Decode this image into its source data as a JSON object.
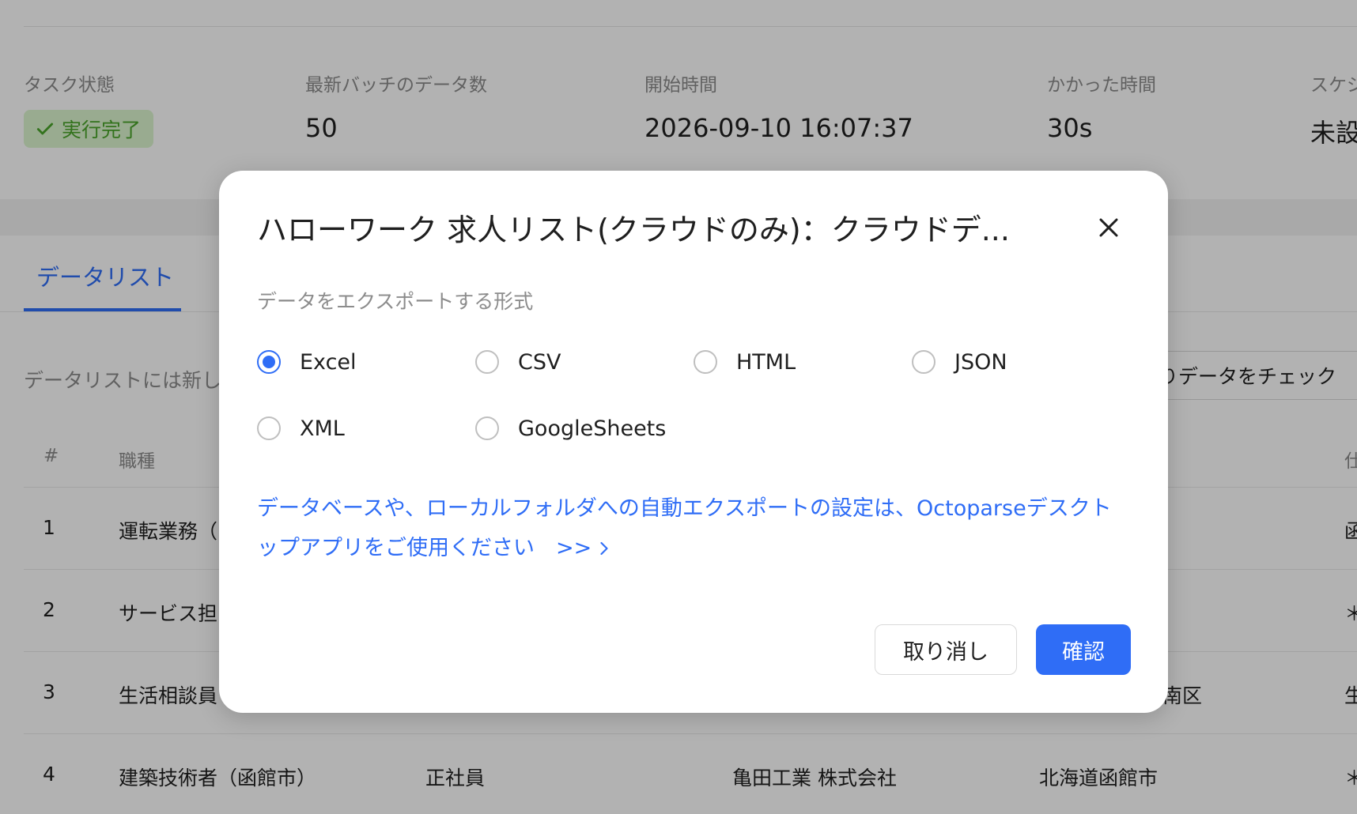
{
  "stats": {
    "task_status": {
      "label": "タスク状態",
      "value": "実行完了"
    },
    "latest_batch": {
      "label": "最新バッチのデータ数",
      "value": "50"
    },
    "start_time": {
      "label": "開始時間",
      "value": "2026-09-10 16:07:37"
    },
    "duration": {
      "label": "かかった時間",
      "value": "30s"
    },
    "schedule": {
      "label": "スケジ",
      "value": "未設"
    }
  },
  "tabs": {
    "data_list": "データリスト"
  },
  "hint_text": "データリストには新し",
  "check_button_label": "りデータをチェック",
  "table": {
    "headers": [
      "#",
      "職種",
      "仕"
    ],
    "rows": [
      {
        "num": "1",
        "job": "運転業務（",
        "extra": "",
        "right": "函"
      },
      {
        "num": "2",
        "job": "サービス担",
        "extra": "",
        "right": "＊"
      },
      {
        "num": "3",
        "job": "生活相談員",
        "extra": "南区",
        "right": "生"
      },
      {
        "num": "4",
        "job": "建築技術者（函館市）",
        "type": "正社員",
        "company": "亀田工業 株式会社",
        "place": "北海道函館市",
        "right": "＊"
      }
    ]
  },
  "modal": {
    "title": "ハローワーク 求人リスト(クラウドのみ)：クラウドデ...",
    "format_label": "データをエクスポートする形式",
    "formats": [
      {
        "label": "Excel",
        "selected": true
      },
      {
        "label": "CSV",
        "selected": false
      },
      {
        "label": "HTML",
        "selected": false
      },
      {
        "label": "JSON",
        "selected": false
      },
      {
        "label": "XML",
        "selected": false
      },
      {
        "label": "GoogleSheets",
        "selected": false
      }
    ],
    "desktop_link": "データベースや、ローカルフォルダへの自動エクスポートの設定は、Octoparseデスクトップアプリをご使用ください　>>",
    "cancel_label": "取り消し",
    "confirm_label": "確認"
  },
  "colors": {
    "accent": "#2f6df6",
    "success": "#4aa52a",
    "success_bg": "#dcf5cf"
  }
}
